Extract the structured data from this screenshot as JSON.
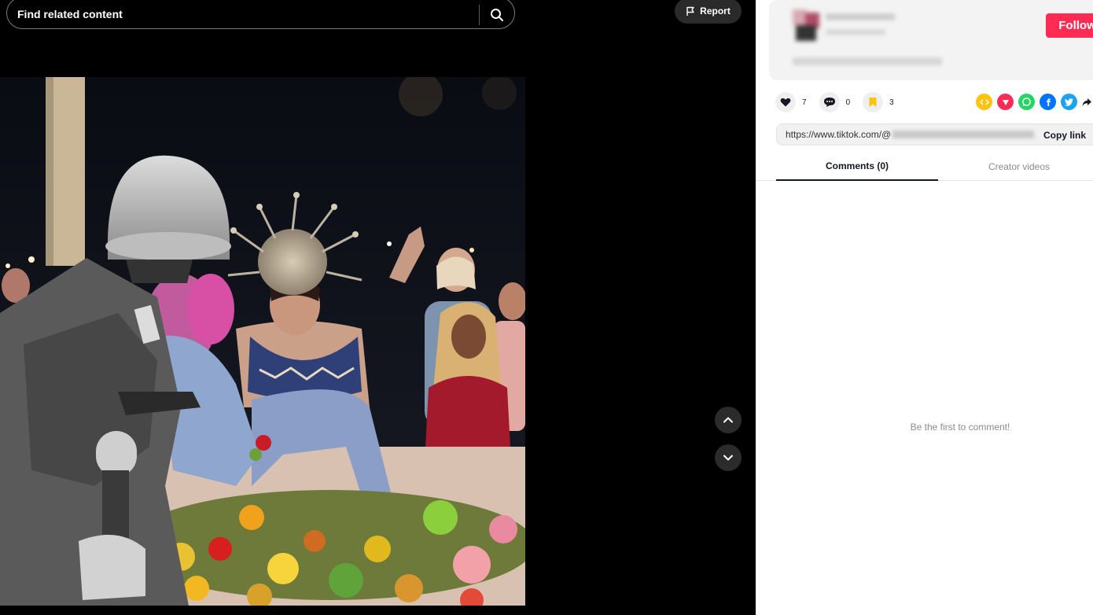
{
  "search": {
    "placeholder": "Find related content",
    "icon": "search-icon"
  },
  "report": {
    "label": "Report",
    "icon": "flag-icon"
  },
  "video_nav": {
    "up_icon": "chevron-up-icon",
    "down_icon": "chevron-down-icon"
  },
  "author": {
    "follow_label": "Follow"
  },
  "actions": {
    "likes": {
      "icon": "heart-icon",
      "count": "7"
    },
    "comments": {
      "icon": "comment-icon",
      "count": "0"
    },
    "favorites": {
      "icon": "bookmark-icon",
      "count": "3"
    }
  },
  "share": {
    "icons": [
      "embed-icon",
      "send-to-friends-icon",
      "whatsapp-icon",
      "facebook-icon",
      "twitter-icon",
      "share-arrow-icon"
    ],
    "colors": {
      "embed": "#fec30d",
      "friends": "#fe2c55",
      "whatsapp": "#25d366",
      "facebook": "#0075fa",
      "twitter": "#1da1f2"
    }
  },
  "link": {
    "url_prefix": "https://www.tiktok.com/@",
    "copy_label": "Copy link"
  },
  "tabs": {
    "comments": "Comments (0)",
    "creator": "Creator videos"
  },
  "comments_empty": "Be the first to comment!",
  "colors": {
    "accent": "#fe2c55",
    "panel_bg": "#ffffff",
    "page_bg": "#000000"
  }
}
